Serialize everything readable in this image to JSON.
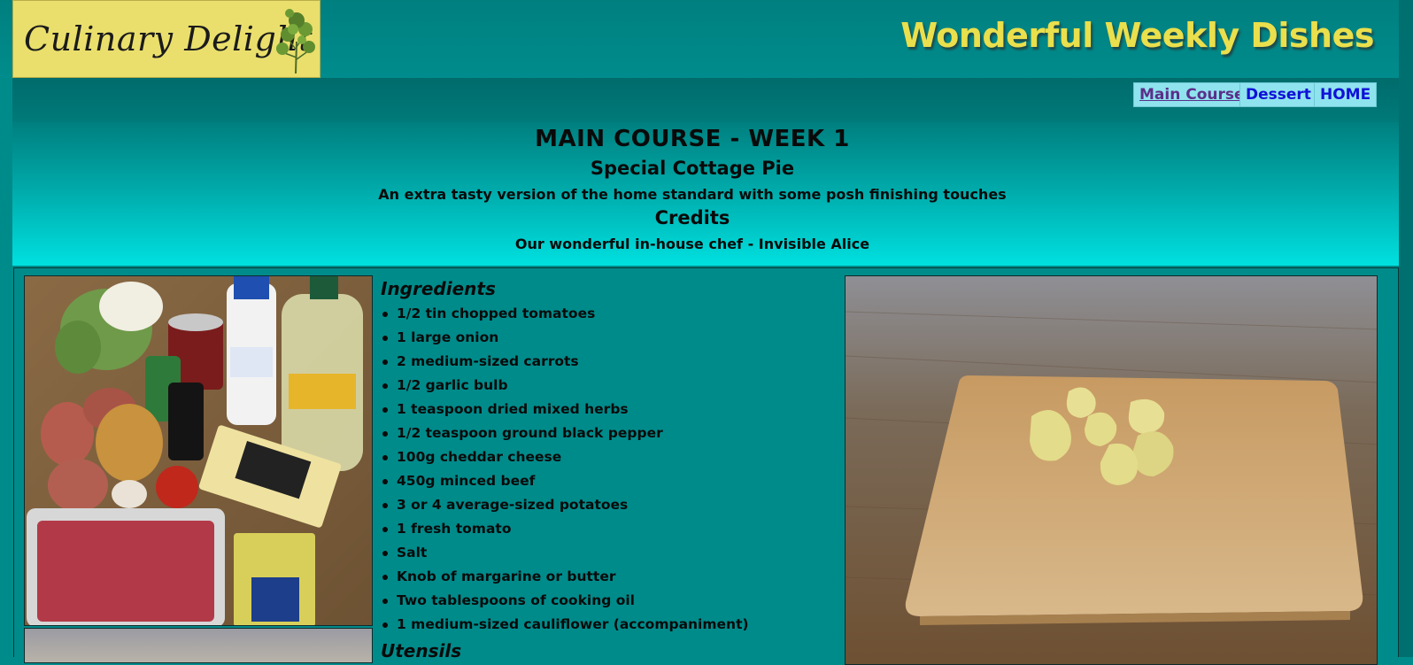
{
  "header": {
    "logo_text": "Culinary Delight",
    "site_title": "Wonderful Weekly Dishes"
  },
  "nav": {
    "items": [
      {
        "label": "Main Course",
        "active": true
      },
      {
        "label": "Dessert"
      },
      {
        "label": "HOME"
      }
    ]
  },
  "page": {
    "week_heading": "MAIN COURSE - WEEK 1",
    "dish_title": "Special Cottage Pie",
    "description": "An extra tasty version of the home standard with some posh finishing touches",
    "credits_heading": "Credits",
    "credits_text": "Our wonderful in-house chef - Invisible Alice"
  },
  "ingredients": {
    "heading": "Ingredients",
    "items": [
      "1/2 tin chopped tomatoes",
      "1 large onion",
      "2 medium-sized carrots",
      "1/2 garlic bulb",
      "1 teaspoon dried mixed herbs",
      "1/2 teaspoon ground black pepper",
      "100g cheddar cheese",
      "450g minced beef",
      "3 or 4 average-sized potatoes",
      "1 fresh tomato",
      "Salt",
      "Knob of margarine or butter",
      "Two tablespoons of cooking oil",
      "1 medium-sized cauliflower (accompaniment)"
    ]
  },
  "utensils": {
    "heading": "Utensils"
  },
  "colors": {
    "background": "#008b8b",
    "logo_bg": "#eadf6c",
    "title_yellow": "#eadf4c",
    "nav_bg": "#8fe3ee",
    "nav_link": "#1010d8",
    "nav_visited": "#5b2f8a"
  }
}
